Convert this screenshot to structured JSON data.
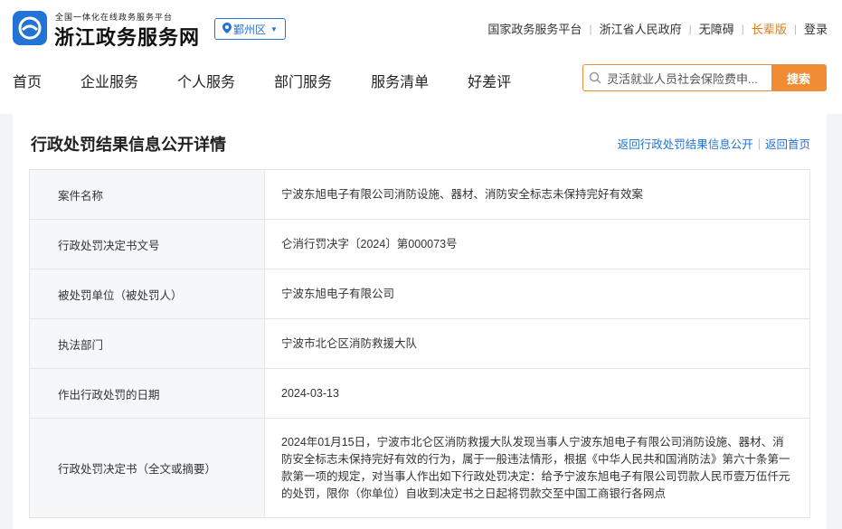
{
  "brand": {
    "subtitle": "全国一体化在线政务服务平台",
    "name": "浙江政务服务网",
    "region": "鄞州区"
  },
  "top_links": [
    "国家政务服务平台",
    "浙江省人民政府",
    "无障碍",
    "长辈版",
    "登录"
  ],
  "nav": [
    "首页",
    "企业服务",
    "个人服务",
    "部门服务",
    "服务清单",
    "好差评"
  ],
  "search": {
    "value": "灵活就业人员社会保险费申...",
    "button": "搜索"
  },
  "page": {
    "title": "行政处罚结果信息公开详情",
    "back_list": "返回行政处罚结果信息公开",
    "back_home": "返回首页"
  },
  "rows": [
    {
      "key": "案件名称",
      "value": "宁波东旭电子有限公司消防设施、器材、消防安全标志未保持完好有效案"
    },
    {
      "key": "行政处罚决定书文号",
      "value": "仑消行罚决字〔2024〕第000073号"
    },
    {
      "key": "被处罚单位（被处罚人）",
      "value": "宁波东旭电子有限公司"
    },
    {
      "key": "执法部门",
      "value": "宁波市北仑区消防救援大队"
    },
    {
      "key": "作出行政处罚的日期",
      "value": "2024-03-13"
    },
    {
      "key": "行政处罚决定书（全文或摘要）",
      "value": "2024年01月15日，宁波市北仑区消防救援大队发现当事人宁波东旭电子有限公司消防设施、器材、消防安全标志未保持完好有效的行为，属于一般违法情形，根据《中华人民共和国消防法》第六十条第一款第一项的规定，对当事人作出如下行政处罚决定：给予宁波东旭电子有限公司罚款人民币壹万伍仟元的处罚，限你（你单位）自收到决定书之日起将罚款交至中国工商银行各网点"
    }
  ],
  "colors": {
    "accent": "#2273d4",
    "search_orange": "#f08c34",
    "elder": "#e07a17"
  }
}
